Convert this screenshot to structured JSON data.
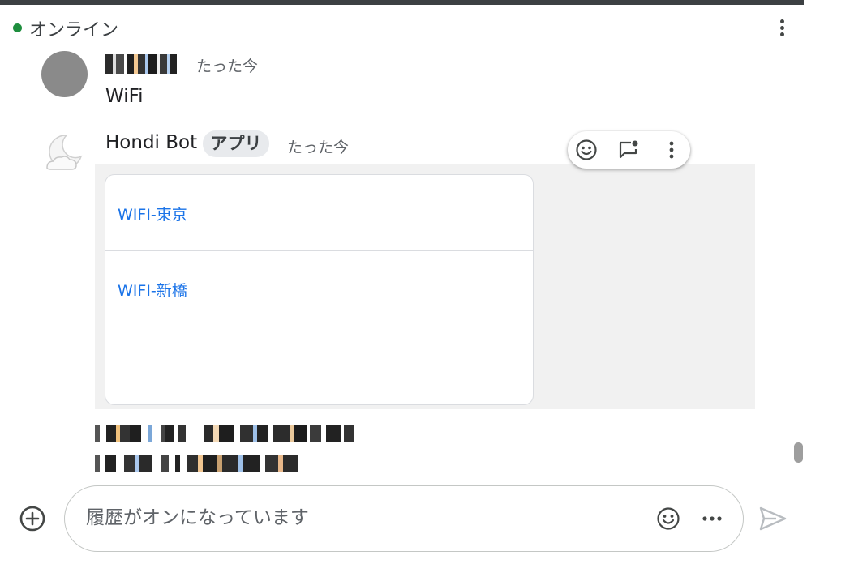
{
  "header": {
    "status_text": "オンライン",
    "status_color": "#1e8e3e",
    "menu_icon": "more-vert-icon"
  },
  "messages": [
    {
      "sender": "redacted",
      "timestamp": "たった今",
      "text": "WiFi"
    },
    {
      "sender": "Hondi Bot",
      "badge": "アプリ",
      "timestamp": "たった今",
      "card": {
        "items": [
          {
            "label": "WIFI-東京"
          },
          {
            "label": "WIFI-新橋"
          },
          {
            "label": ""
          }
        ]
      }
    }
  ],
  "hover_actions": [
    {
      "name": "add-reaction",
      "icon": "emoji-icon"
    },
    {
      "name": "reply-in-thread",
      "icon": "thread-reply-icon"
    },
    {
      "name": "more-actions",
      "icon": "more-vert-icon"
    }
  ],
  "composer": {
    "placeholder": "履歴がオンになっています",
    "value": "",
    "add_icon": "add-circle-icon",
    "emoji_icon": "emoji-icon",
    "more_icon": "more-horiz-icon",
    "send_icon": "send-icon"
  },
  "colors": {
    "link": "#1a73e8",
    "card_area": "#f1f1f1",
    "top_bar": "#3c4043"
  }
}
